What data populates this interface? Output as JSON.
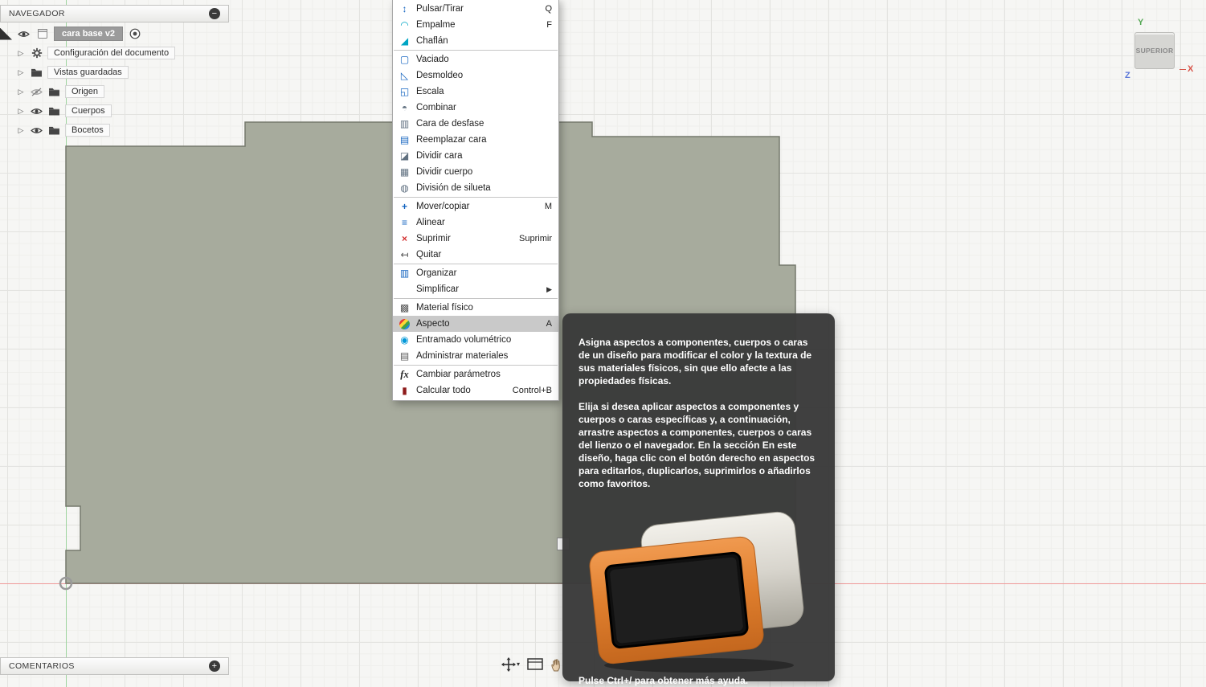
{
  "navigator": {
    "title": "NAVEGADOR",
    "collapse_label": "−",
    "root": {
      "label": "cara base v2"
    },
    "items": [
      {
        "label": "Configuración del documento",
        "icon": "gear-icon",
        "eye": null
      },
      {
        "label": "Vistas guardadas",
        "icon": "folder-icon",
        "eye": null
      },
      {
        "label": "Origen",
        "icon": "folder-icon",
        "eye": "off"
      },
      {
        "label": "Cuerpos",
        "icon": "folder-icon",
        "eye": "on"
      },
      {
        "label": "Bocetos",
        "icon": "folder-icon",
        "eye": "on"
      }
    ]
  },
  "comments": {
    "title": "COMENTARIOS",
    "add_label": "+"
  },
  "context_menu": {
    "items": [
      {
        "label": "Pulsar/Tirar",
        "shortcut": "Q",
        "icon": "push-pull-icon"
      },
      {
        "label": "Empalme",
        "shortcut": "F",
        "icon": "fillet-icon"
      },
      {
        "label": "Chaflán",
        "icon": "chamfer-icon"
      },
      {
        "separator": true
      },
      {
        "label": "Vaciado",
        "icon": "shell-icon"
      },
      {
        "label": "Desmoldeo",
        "icon": "draft-icon"
      },
      {
        "label": "Escala",
        "icon": "scale-icon"
      },
      {
        "label": "Combinar",
        "icon": "combine-icon"
      },
      {
        "label": "Cara de desfase",
        "icon": "offset-face-icon"
      },
      {
        "label": "Reemplazar cara",
        "icon": "replace-face-icon"
      },
      {
        "label": "Dividir cara",
        "icon": "split-face-icon"
      },
      {
        "label": "Dividir cuerpo",
        "icon": "split-body-icon"
      },
      {
        "label": "División de silueta",
        "icon": "silhouette-split-icon"
      },
      {
        "separator": true
      },
      {
        "label": "Mover/copiar",
        "shortcut": "M",
        "icon": "move-copy-icon"
      },
      {
        "label": "Alinear",
        "icon": "align-icon"
      },
      {
        "label": "Suprimir",
        "shortcut": "Suprimir",
        "icon": "delete-icon"
      },
      {
        "label": "Quitar",
        "icon": "remove-icon"
      },
      {
        "separator": true
      },
      {
        "label": "Organizar",
        "icon": "arrange-icon"
      },
      {
        "label": "Simplificar",
        "submenu": true
      },
      {
        "separator": true
      },
      {
        "label": "Material físico",
        "icon": "physical-material-icon"
      },
      {
        "label": "Aspecto",
        "shortcut": "A",
        "icon": "appearance-icon",
        "highlighted": true
      },
      {
        "label": "Entramado volumétrico",
        "icon": "volumetric-lattice-icon"
      },
      {
        "label": "Administrar materiales",
        "icon": "manage-materials-icon"
      },
      {
        "separator": true
      },
      {
        "label": "Cambiar parámetros",
        "icon": "fx-icon"
      },
      {
        "label": "Calcular todo",
        "shortcut": "Control+B",
        "icon": "compute-all-icon"
      }
    ]
  },
  "tooltip": {
    "paragraph1": "Asigna aspectos a componentes, cuerpos o caras de un diseño para modificar el color y la textura de sus materiales físicos, sin que ello afecte a las propiedades físicas.",
    "paragraph2": "Elija si desea aplicar aspectos a componentes y cuerpos o caras específicas y, a continuación, arrastre aspectos a componentes, cuerpos o caras del lienzo o el navegador. En la sección En este diseño, haga clic con el botón derecho en aspectos para editarlos, duplicarlos, suprimirlos o añadirlos como favoritos.",
    "footer": "Pulse Ctrl+/ para obtener más ayuda."
  },
  "viewcube": {
    "face_label": "SUPERIOR",
    "axis_x": "X",
    "axis_y": "Y",
    "axis_z": "Z"
  },
  "colors": {
    "body_fill": "#a7ab9d",
    "body_stroke": "#75796d",
    "axis_x": "#f09a9a",
    "axis_y": "#9ed49e",
    "menu_highlight": "#c9c9c9",
    "appearance_orange": "#e07f2e"
  }
}
